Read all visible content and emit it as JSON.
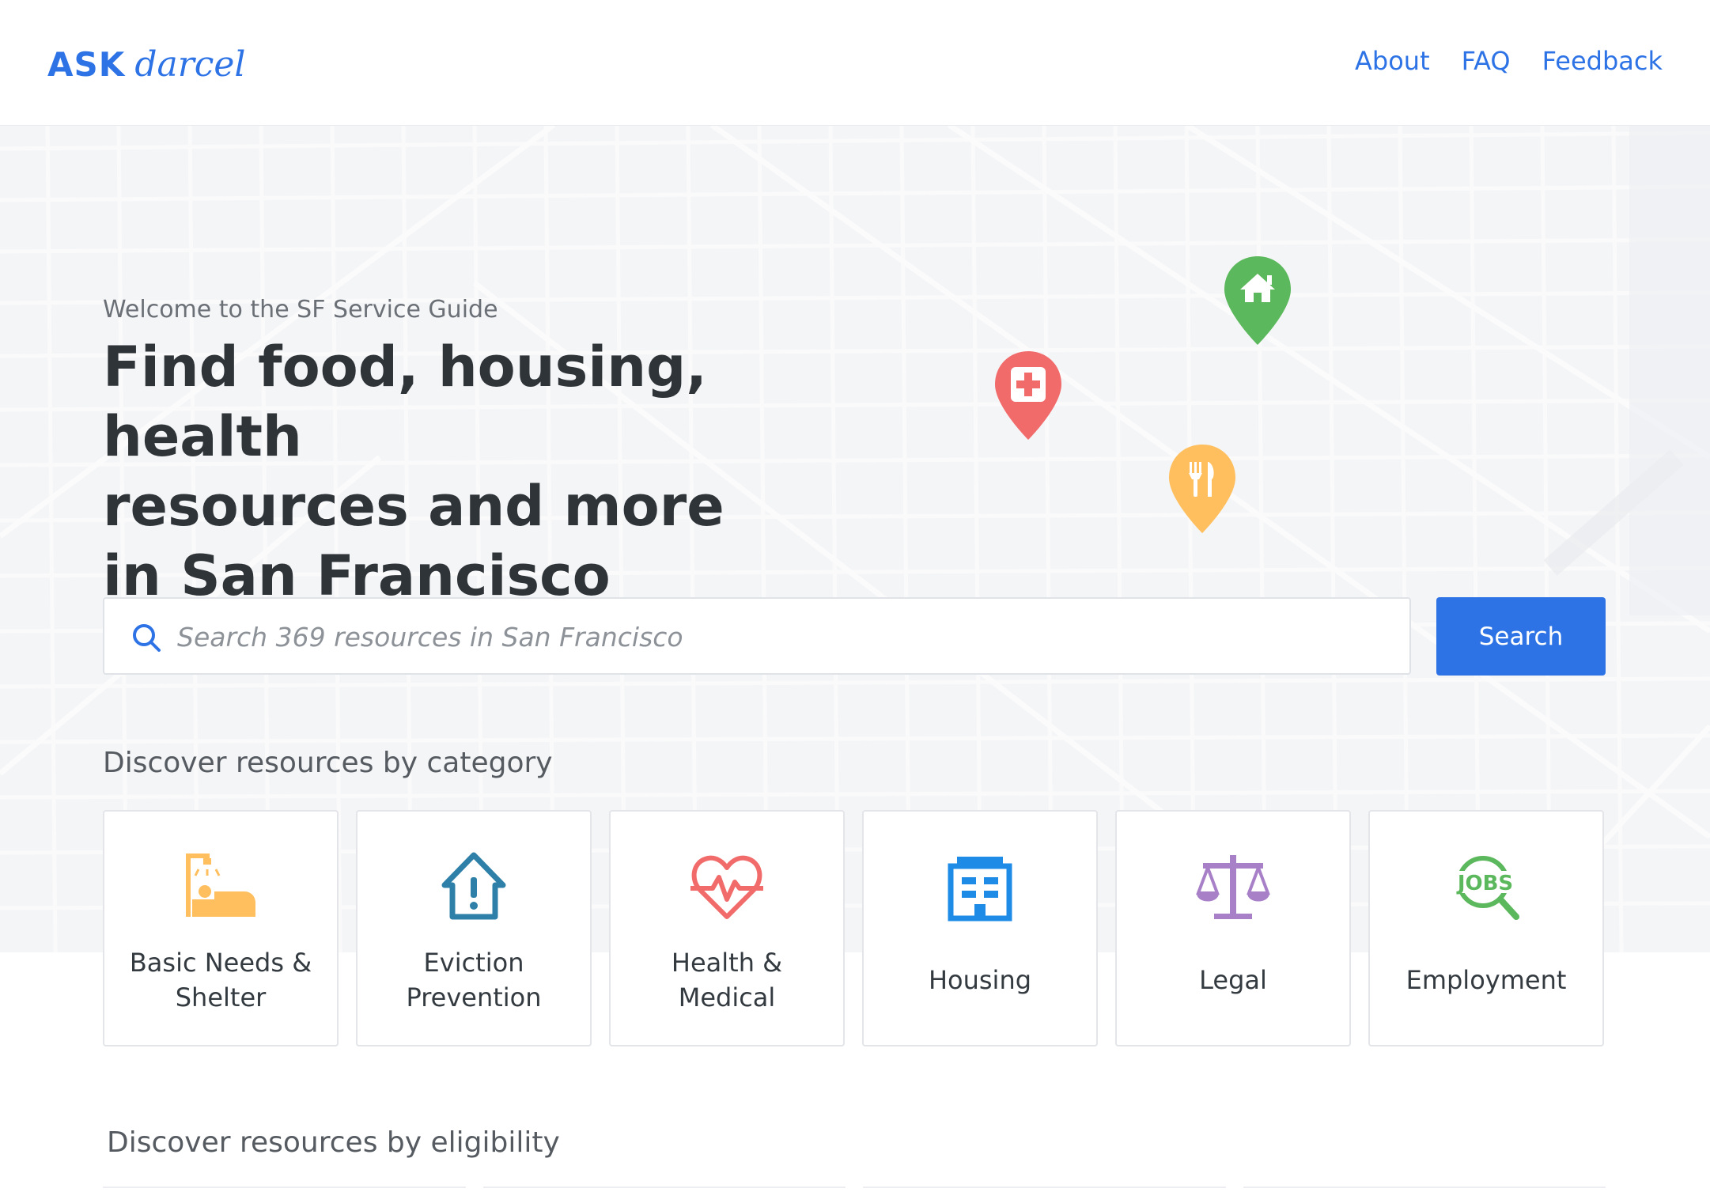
{
  "header": {
    "logo_ask": "ASK",
    "logo_darcel": "darcel",
    "nav": {
      "about": "About",
      "faq": "FAQ",
      "feedback": "Feedback"
    }
  },
  "hero": {
    "welcome": "Welcome to the SF Service Guide",
    "headline_lines": [
      "Find food, housing, health",
      "resources and more",
      "in San Francisco"
    ],
    "pins": [
      {
        "name": "housing-pin",
        "color": "#5cb85c",
        "icon": "house-icon"
      },
      {
        "name": "medical-pin",
        "color": "#f26b6b",
        "icon": "medical-cross-icon"
      },
      {
        "name": "food-pin",
        "color": "#ffbf5e",
        "icon": "fork-knife-icon"
      }
    ]
  },
  "search": {
    "placeholder": "Search 369 resources in San Francisco",
    "value": "",
    "button_label": "Search"
  },
  "categories": {
    "title": "Discover resources by category",
    "items": [
      {
        "label": "Basic Needs & Shelter",
        "icon": "shower-bed-icon",
        "color": "#ffbf5e"
      },
      {
        "label": "Eviction Prevention",
        "icon": "house-alert-icon",
        "color": "#2f80a8"
      },
      {
        "label": "Health & Medical",
        "icon": "heartbeat-icon",
        "color": "#f26b6b"
      },
      {
        "label": "Housing",
        "icon": "building-icon",
        "color": "#1e8be6"
      },
      {
        "label": "Legal",
        "icon": "scales-icon",
        "color": "#a880c8"
      },
      {
        "label": "Employment",
        "icon": "jobs-search-icon",
        "color": "#5cb85c"
      }
    ]
  },
  "eligibility": {
    "title": "Discover resources by eligibility"
  },
  "colors": {
    "accent": "#2d73e6",
    "map_bg": "#f4f5f7"
  }
}
